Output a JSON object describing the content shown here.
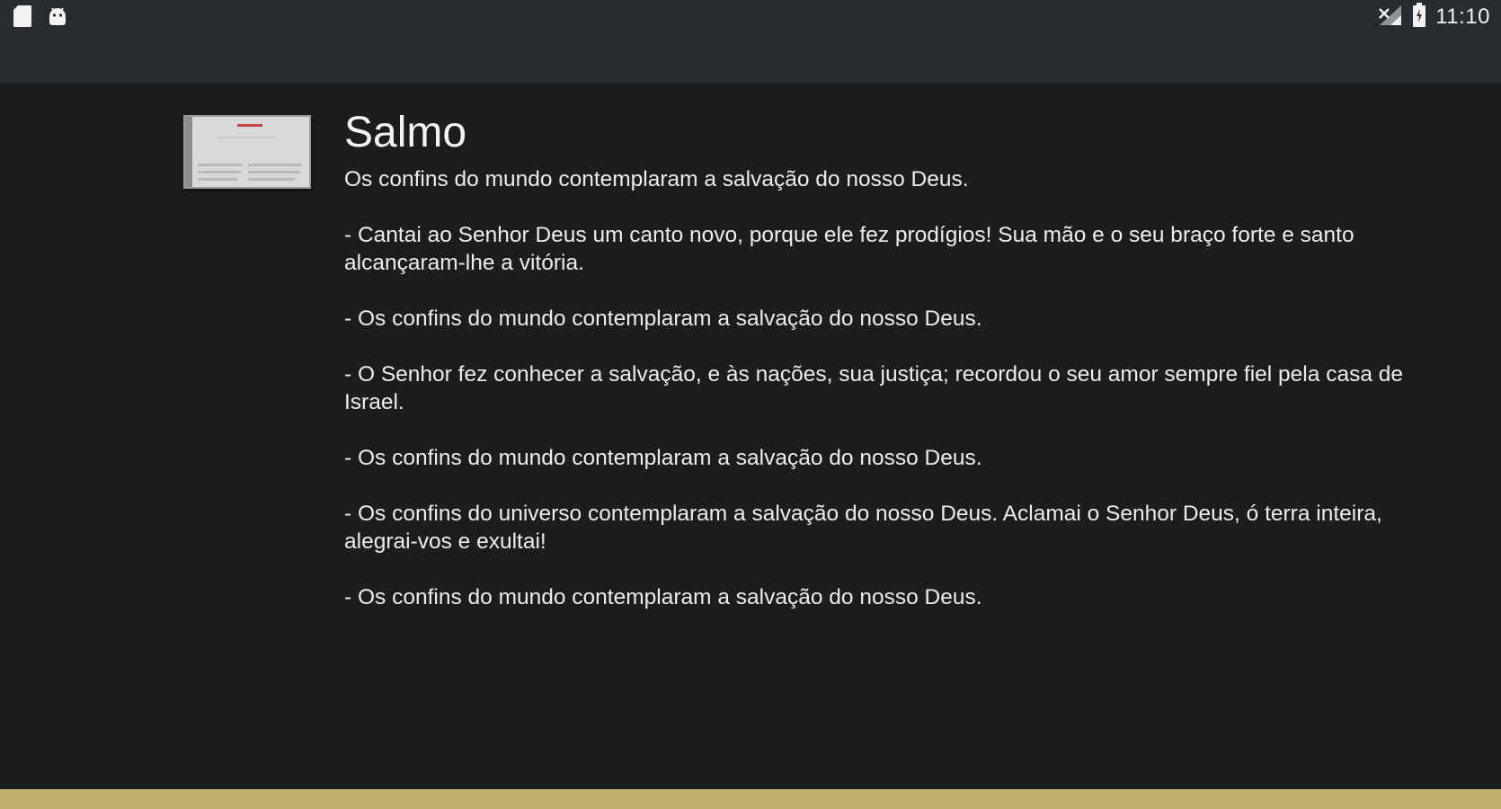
{
  "status_bar": {
    "time": "11:10",
    "left_icons": [
      "sd-card-icon",
      "android-icon"
    ],
    "right_icons": [
      "signal-icon",
      "battery-icon"
    ]
  },
  "reading": {
    "title": "Salmo",
    "paragraphs": [
      "Os confins do mundo contemplaram a salvação do nosso Deus.",
      "- Cantai ao Senhor Deus um canto novo, porque ele fez prodígios! Sua mão e o seu braço forte e santo alcançaram-lhe a vitória.",
      "- Os confins do mundo contemplaram a salvação do nosso Deus.",
      "- O Senhor fez conhecer a salvação, e às nações, sua justiça; recordou o seu amor sempre fiel pela casa de Israel.",
      "- Os confins do mundo contemplaram a salvação do nosso Deus.",
      "- Os confins do universo contemplaram a salvação do nosso Deus. Aclamai o Senhor Deus, ó terra inteira, alegrai-vos e exultai!",
      "- Os confins do mundo contemplaram a salvação do nosso Deus."
    ]
  },
  "colors": {
    "status_bar": "#272c31",
    "background": "#1c1d1f",
    "text": "#ededed",
    "bottom_accent": "#c4b06e"
  }
}
